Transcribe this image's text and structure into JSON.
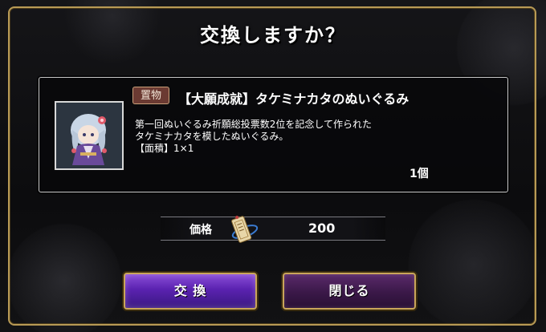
{
  "dialog": {
    "title": "交換しますか？"
  },
  "item": {
    "tag": "置物",
    "name": "【大願成就】タケミナカタのぬいぐるみ",
    "description_lines": [
      "第一回ぬいぐるみ祈願総投票数2位を記念して作られた",
      "タケミナカタを模したぬいぐるみ。",
      "【面積】1×1"
    ],
    "quantity": "1個",
    "thumbnail_icon": "plush-character-thumbnail"
  },
  "price": {
    "label": "価格",
    "value": "200",
    "icon": "ticket-icon"
  },
  "buttons": {
    "exchange": "交 換",
    "close": "閉じる"
  },
  "colors": {
    "gold_border": "#c9a55a",
    "exchange_button": "#6a30c8",
    "close_button": "#3a1848",
    "tag_bg": "#6b3a32"
  }
}
